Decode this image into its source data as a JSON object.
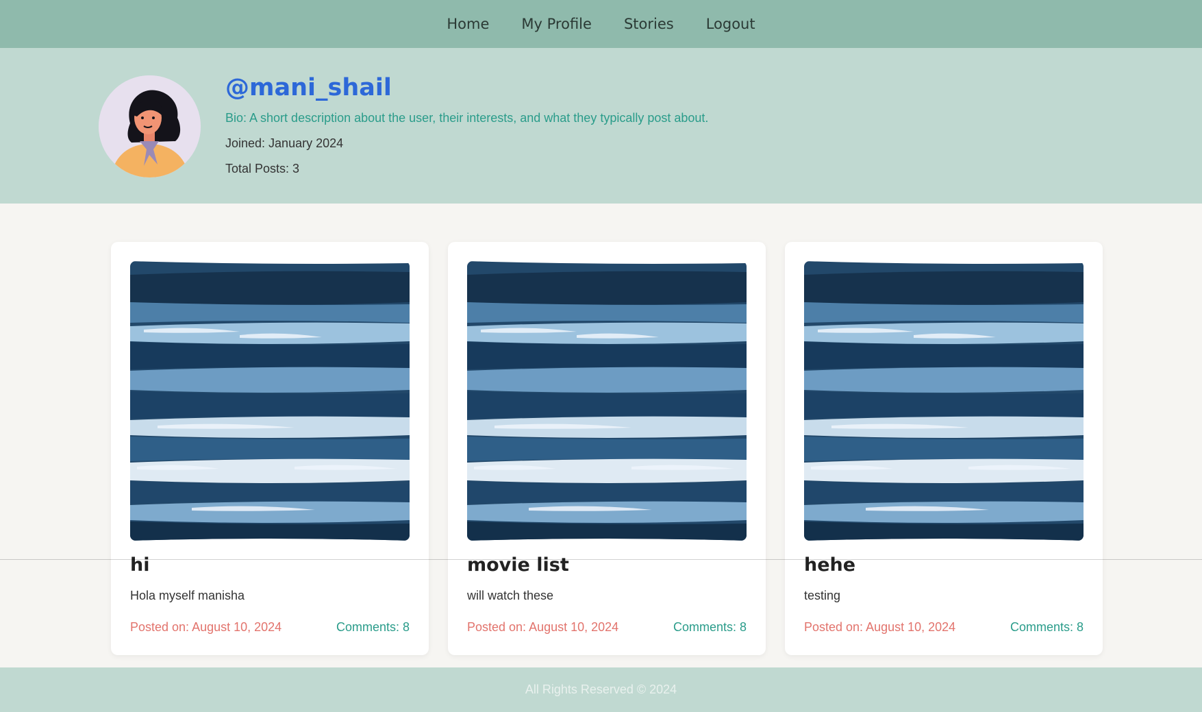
{
  "nav": {
    "items": [
      "Home",
      "My Profile",
      "Stories",
      "Logout"
    ]
  },
  "profile": {
    "avatar_icon": "woman-avatar-icon",
    "username": "@mani_shail",
    "bio": "Bio: A short description about the user, their interests, and what they typically post about.",
    "joined": "Joined: January 2024",
    "total_posts": "Total Posts: 3"
  },
  "posts": [
    {
      "title": "hi",
      "description": "Hola myself manisha",
      "posted": "Posted on: August 10, 2024",
      "comments": "Comments: 8",
      "image": "blue-abstract-painting"
    },
    {
      "title": "movie list",
      "description": "will watch these",
      "posted": "Posted on: August 10, 2024",
      "comments": "Comments: 8",
      "image": "blue-abstract-painting"
    },
    {
      "title": "hehe",
      "description": "testing",
      "posted": "Posted on: August 10, 2024",
      "comments": "Comments: 8",
      "image": "blue-abstract-painting"
    }
  ],
  "footer": {
    "text": "All Rights Reserved © 2024"
  },
  "colors": {
    "nav_bg": "#8fbaac",
    "header_bg": "#c0d9d1",
    "page_bg": "#f6f5f2",
    "username": "#2d68d8",
    "bio": "#2a9c8a",
    "posted": "#e2736c",
    "comments": "#2a9c8a"
  }
}
